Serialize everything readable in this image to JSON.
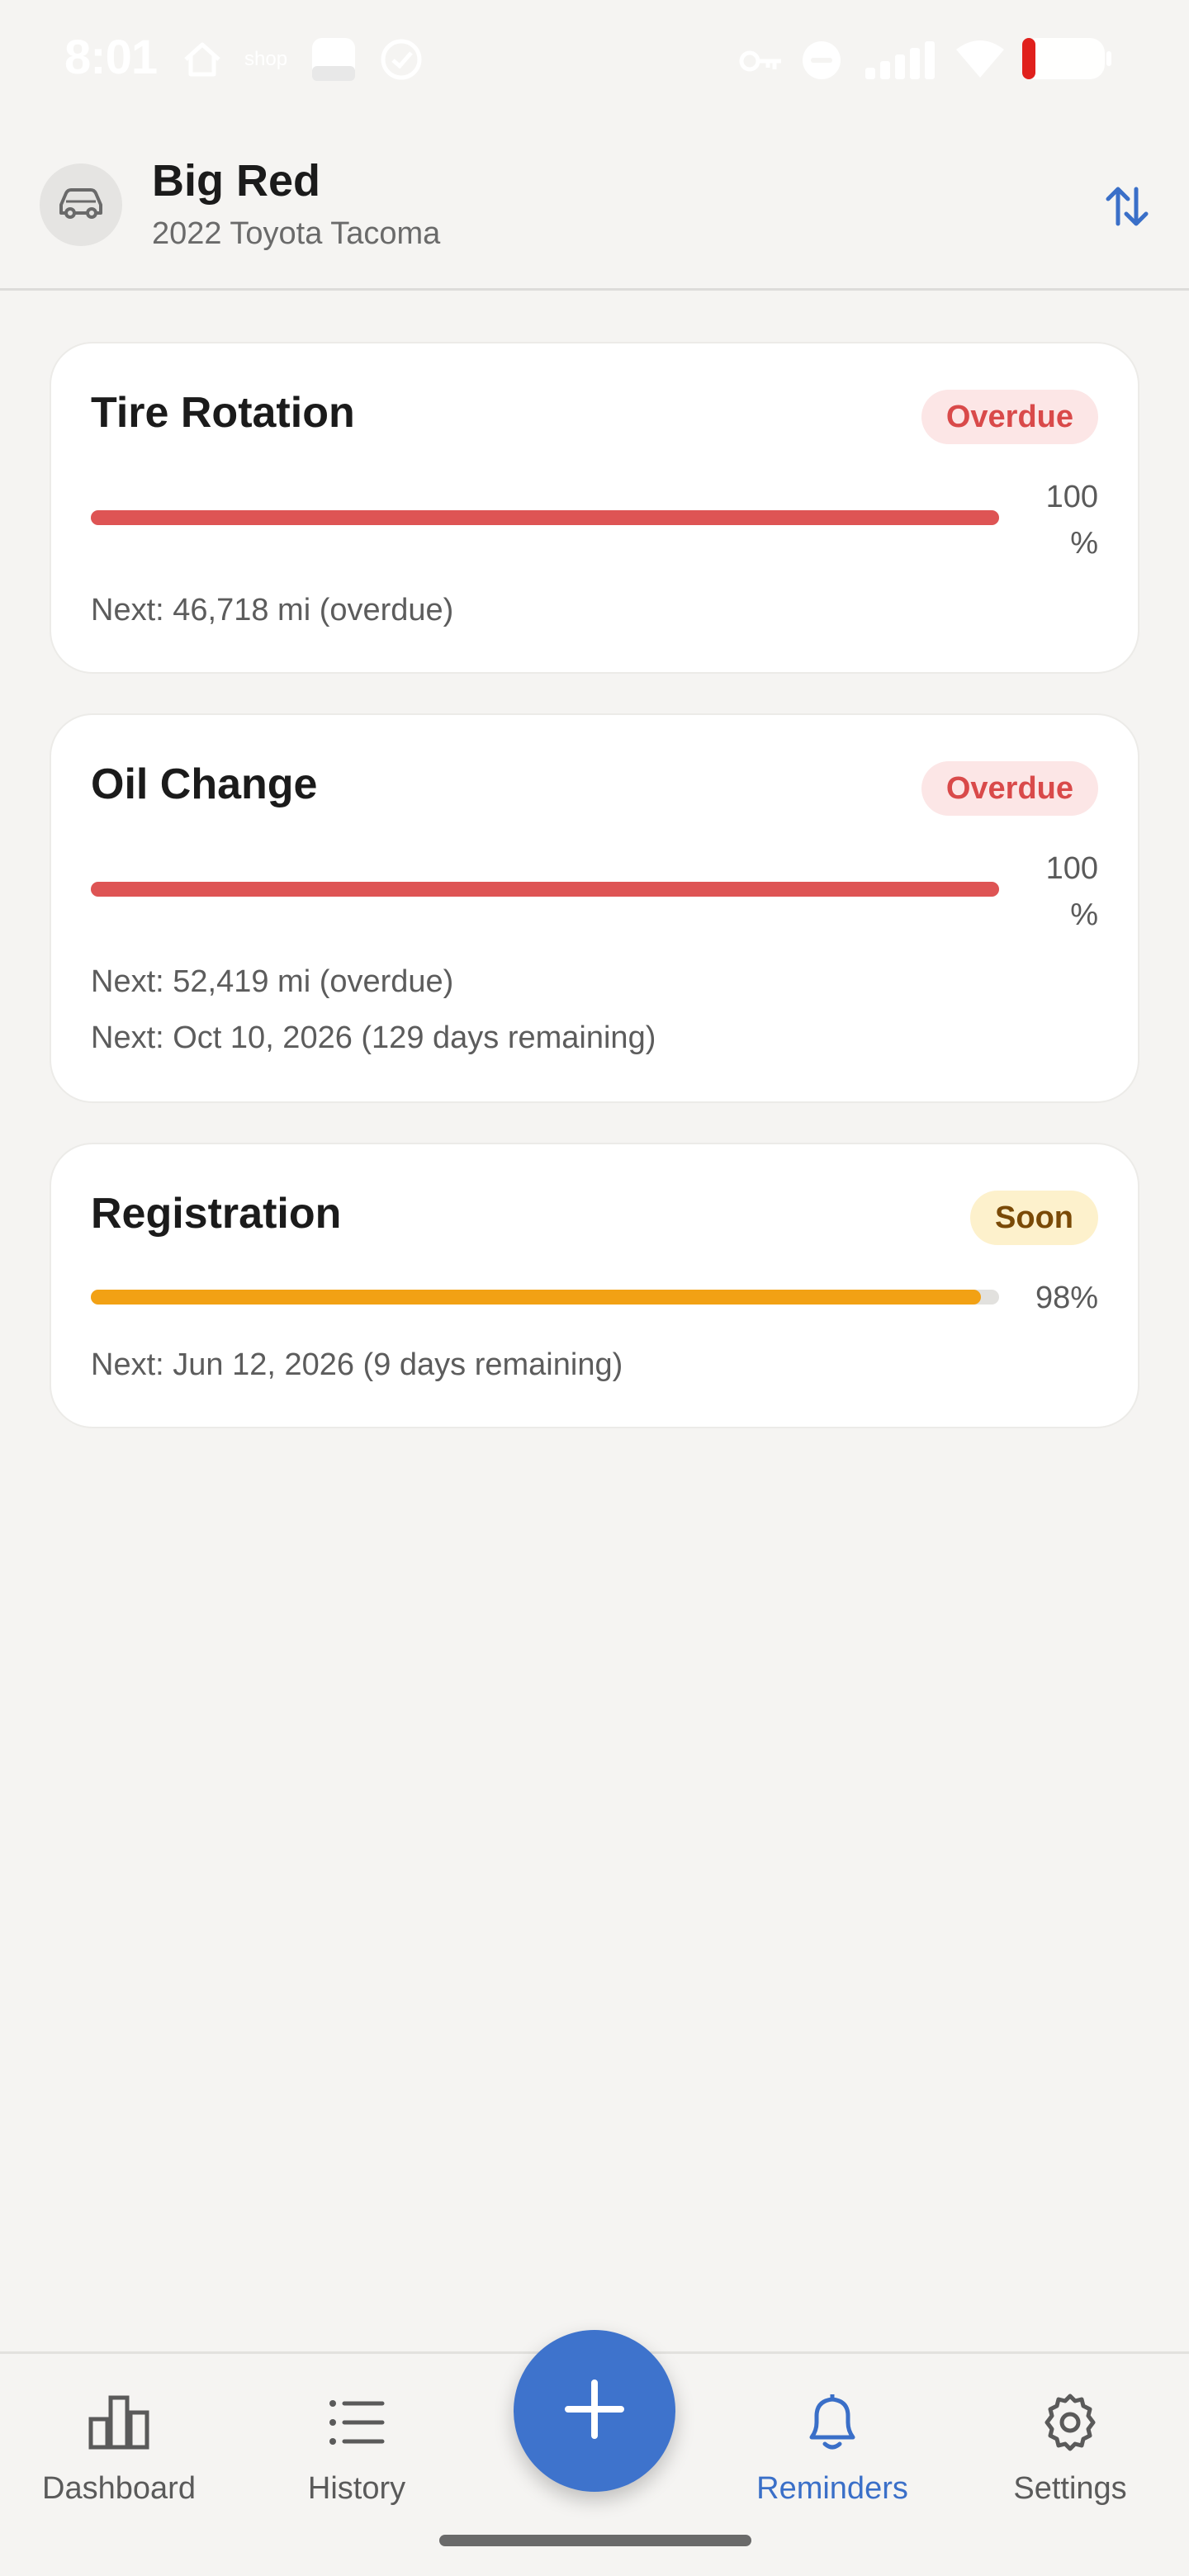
{
  "status_bar": {
    "time": "8:01",
    "shop_label": "shop",
    "left_icons": [
      "home-icon",
      "shop-icon",
      "app-icon",
      "check-circle-icon"
    ],
    "right_icons": [
      "key-icon",
      "dnd-icon",
      "signal-icon",
      "wifi-icon",
      "battery-icon"
    ],
    "battery_color": "#E0201C"
  },
  "header": {
    "vehicle_name": "Big Red",
    "vehicle_model": "2022 Toyota Tacoma",
    "avatar_icon": "car-icon",
    "sort_icon": "sort-arrows-icon"
  },
  "reminders": [
    {
      "title": "Tire Rotation",
      "status": "Overdue",
      "status_kind": "overdue",
      "progress": 100,
      "progress_line1": "100",
      "progress_line2": "%",
      "next": [
        "Next: 46,718 mi (overdue)"
      ],
      "color": "#DE5454"
    },
    {
      "title": "Oil Change",
      "status": "Overdue",
      "status_kind": "overdue",
      "progress": 100,
      "progress_line1": "100",
      "progress_line2": "%",
      "next": [
        "Next: 52,419 mi (overdue)",
        "Next: Oct 10, 2026 (129 days remaining)"
      ],
      "color": "#DE5454"
    },
    {
      "title": "Registration",
      "status": "Soon",
      "status_kind": "soon",
      "progress": 98,
      "progress_line1": "98%",
      "progress_line2": "",
      "next": [
        "Next: Jun 12, 2026 (9 days remaining)"
      ],
      "color": "#F2A114"
    }
  ],
  "nav": {
    "items": [
      {
        "label": "Dashboard",
        "icon": "bar-chart-icon",
        "active": false
      },
      {
        "label": "History",
        "icon": "list-icon",
        "active": false
      },
      {
        "label": "Reminders",
        "icon": "bell-icon",
        "active": true
      },
      {
        "label": "Settings",
        "icon": "gear-icon",
        "active": false
      }
    ],
    "fab_icon": "plus-icon"
  },
  "colors": {
    "accent": "#3E73CC",
    "overdue": "#DE5454",
    "soon": "#F2A114",
    "background": "#F5F4F2"
  }
}
